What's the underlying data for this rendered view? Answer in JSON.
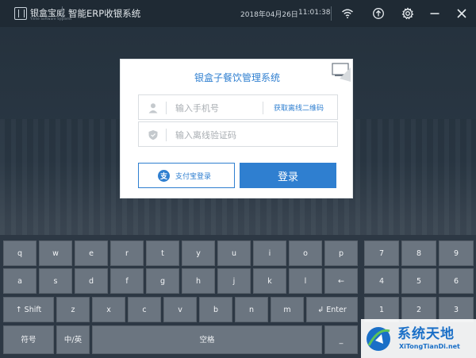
{
  "topbar": {
    "logo_text": "银盒宝威",
    "logo_subtext": "Yinhe Software Systems",
    "app_title": "智能ERP收银系统",
    "date": "2018年04月26日",
    "time": "11:01:38"
  },
  "login": {
    "title": "银盒子餐饮管理系统",
    "phone_placeholder": "输入手机号",
    "get_qr_label": "获取离线二维码",
    "code_placeholder": "输入离线验证码",
    "alipay_label": "支付宝登录",
    "alipay_glyph": "支",
    "login_label": "登录"
  },
  "keyboard": {
    "row1": [
      "q",
      "w",
      "e",
      "r",
      "t",
      "y",
      "u",
      "i",
      "o",
      "p"
    ],
    "row2": [
      "a",
      "s",
      "d",
      "f",
      "g",
      "h",
      "j",
      "k",
      "l",
      "←"
    ],
    "row3_shift": "↑ Shift",
    "row3": [
      "z",
      "x",
      "c",
      "v",
      "b",
      "n",
      "m"
    ],
    "row3_enter": "↲ Enter",
    "row4": {
      "symbols": "符号",
      "lang": "中/英",
      "space": "空格",
      "dash": "_"
    },
    "numpad": [
      "7",
      "8",
      "9",
      "4",
      "5",
      "6",
      "1",
      "2",
      "3"
    ]
  },
  "watermark": {
    "title": "系统天地",
    "url": "XiTongTianDi.net"
  },
  "colors": {
    "accent": "#2f7fd0",
    "key_bg": "#6b7580",
    "topbar_bg": "#1f2a34"
  }
}
